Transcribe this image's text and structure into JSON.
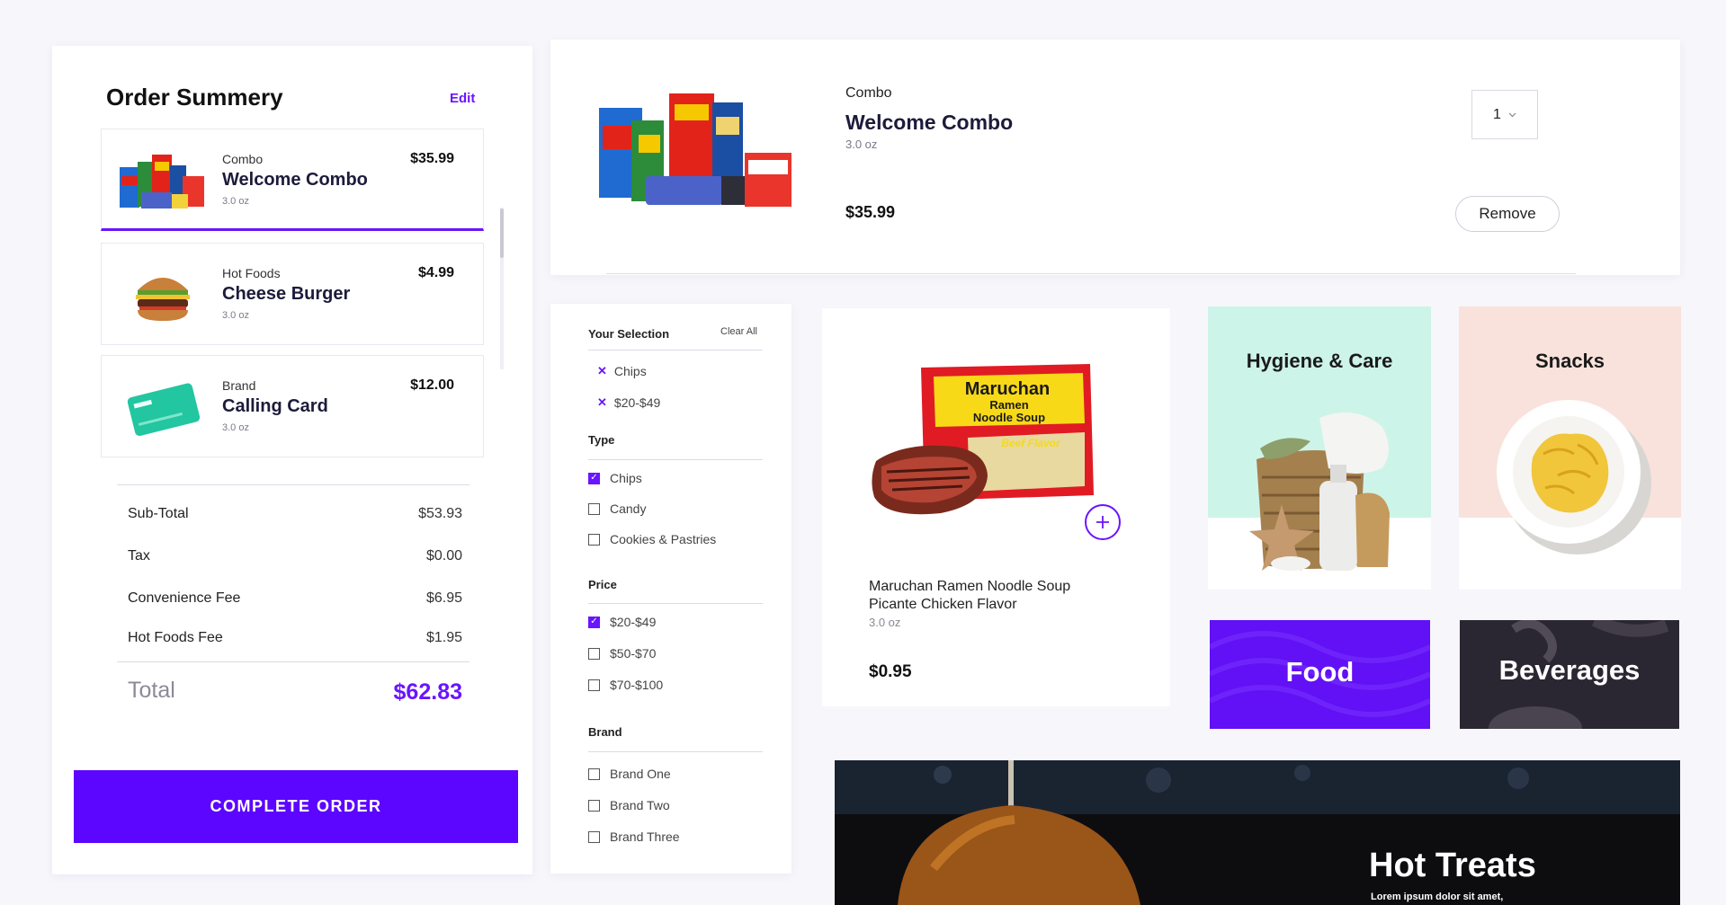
{
  "order_summary": {
    "title": "Order Summery",
    "edit_label": "Edit",
    "items": [
      {
        "category": "Combo",
        "name": "Welcome Combo",
        "size": "3.0 oz",
        "price": "$35.99"
      },
      {
        "category": "Hot Foods",
        "name": "Cheese Burger",
        "size": "3.0 oz",
        "price": "$4.99"
      },
      {
        "category": "Brand",
        "name": "Calling Card",
        "size": "3.0 oz",
        "price": "$12.00"
      }
    ],
    "lines": [
      {
        "label": "Sub-Total",
        "value": "$53.93"
      },
      {
        "label": "Tax",
        "value": "$0.00"
      },
      {
        "label": "Convenience Fee",
        "value": "$6.95"
      },
      {
        "label": "Hot Foods Fee",
        "value": "$1.95"
      }
    ],
    "total_label": "Total",
    "total_value": "$62.83",
    "complete_label": "COMPLETE ORDER"
  },
  "cart_item": {
    "category": "Combo",
    "name": "Welcome Combo",
    "size": "3.0 oz",
    "price": "$35.99",
    "quantity": "1",
    "remove_label": "Remove"
  },
  "filters": {
    "selection_title": "Your Selection",
    "clear_all": "Clear All",
    "selected": [
      "Chips",
      "$20-$49"
    ],
    "type_title": "Type",
    "type_options": [
      {
        "label": "Chips",
        "checked": true
      },
      {
        "label": "Candy",
        "checked": false
      },
      {
        "label": "Cookies & Pastries",
        "checked": false
      }
    ],
    "price_title": "Price",
    "price_options": [
      {
        "label": "$20-$49",
        "checked": true
      },
      {
        "label": "$50-$70",
        "checked": false
      },
      {
        "label": "$70-$100",
        "checked": false
      }
    ],
    "brand_title": "Brand",
    "brand_options": [
      {
        "label": "Brand One",
        "checked": false
      },
      {
        "label": "Brand Two",
        "checked": false
      },
      {
        "label": "Brand Three",
        "checked": false
      }
    ]
  },
  "product": {
    "name": "Maruchan Ramen Noodle Soup Picante Chicken Flavor",
    "size": "3.0 oz",
    "price": "$0.95",
    "package_brand": "Maruchan",
    "package_line1": "Ramen",
    "package_line2": "Noodle Soup",
    "package_flavor": "Beef Flavor"
  },
  "categories": {
    "hygiene": "Hygiene & Care",
    "snacks": "Snacks",
    "food": "Food",
    "beverages": "Beverages"
  },
  "banner": {
    "title": "Hot Treats",
    "subtitle": "Lorem ipsum dolor sit amet,"
  },
  "colors": {
    "accent": "#6a14ff",
    "hygiene_bg": "#cdf4e8",
    "snacks_bg": "#f9e2dc"
  }
}
